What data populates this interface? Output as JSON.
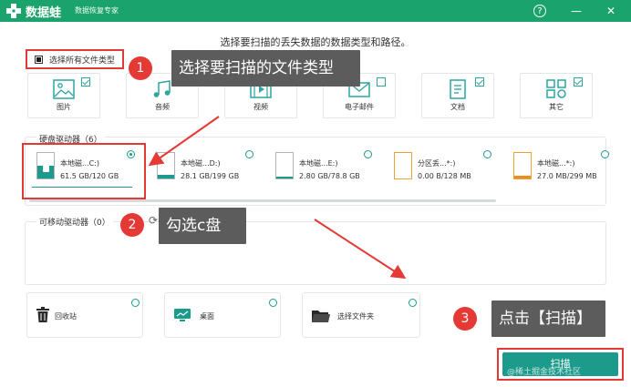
{
  "app": {
    "name": "数据蛙",
    "subtitle": "数据恢复专家"
  },
  "window_controls": {
    "help": "?",
    "minimize": "—",
    "close": "✕"
  },
  "prompt": "选择要扫描的丢失数据的数据类型和路径。",
  "select_all": {
    "label": "选择所有文件类型",
    "checked": true
  },
  "file_types": [
    {
      "label": "图片",
      "checked": true,
      "icon": "image-icon"
    },
    {
      "label": "音频",
      "checked": true,
      "icon": "audio-icon"
    },
    {
      "label": "视频",
      "checked": true,
      "icon": "video-icon"
    },
    {
      "label": "电子邮件",
      "checked": false,
      "icon": "email-icon"
    },
    {
      "label": "文档",
      "checked": true,
      "icon": "document-icon"
    },
    {
      "label": "其它",
      "checked": true,
      "icon": "other-icon"
    }
  ],
  "hard_drives": {
    "title": "硬盘驱动器（6）",
    "items": [
      {
        "name": "本地磁...C:)",
        "size": "61.5 GB/120 GB",
        "used_fraction": 0.51,
        "selected": true,
        "type": "system"
      },
      {
        "name": "本地磁...D:)",
        "size": "28.1 GB/199 GB",
        "used_fraction": 0.14,
        "selected": false,
        "type": "disk"
      },
      {
        "name": "本地磁...E:)",
        "size": "2.80 GB/78.8 GB",
        "used_fraction": 0.04,
        "selected": false,
        "type": "disk"
      },
      {
        "name": "分区丢...*:)",
        "size": "0.00  B/128 MB",
        "used_fraction": 0.0,
        "selected": false,
        "type": "partition"
      },
      {
        "name": "本地磁...*:)",
        "size": "27.0 MB/299 MB",
        "used_fraction": 0.09,
        "selected": false,
        "type": "partition"
      }
    ]
  },
  "removable": {
    "title": "可移动驱动器（0）"
  },
  "locations": [
    {
      "label": "回收站",
      "icon": "recycle-bin-icon"
    },
    {
      "label": "桌面",
      "icon": "desktop-icon"
    },
    {
      "label": "选择文件夹",
      "icon": "folder-icon"
    }
  ],
  "scan_button": "扫描",
  "annotations": {
    "step1_num": "1",
    "step1_text": "选择要扫描的文件类型",
    "step2_num": "2",
    "step2_text": "勾选c盘",
    "step3_num": "3",
    "step3_text": "点击【扫描】"
  },
  "watermark": "@稀土掘金技术社区",
  "colors": {
    "brand": "#1aa36a",
    "accent": "#1c9a8c",
    "highlight": "#e53935",
    "callout": "#5c5c5c"
  }
}
